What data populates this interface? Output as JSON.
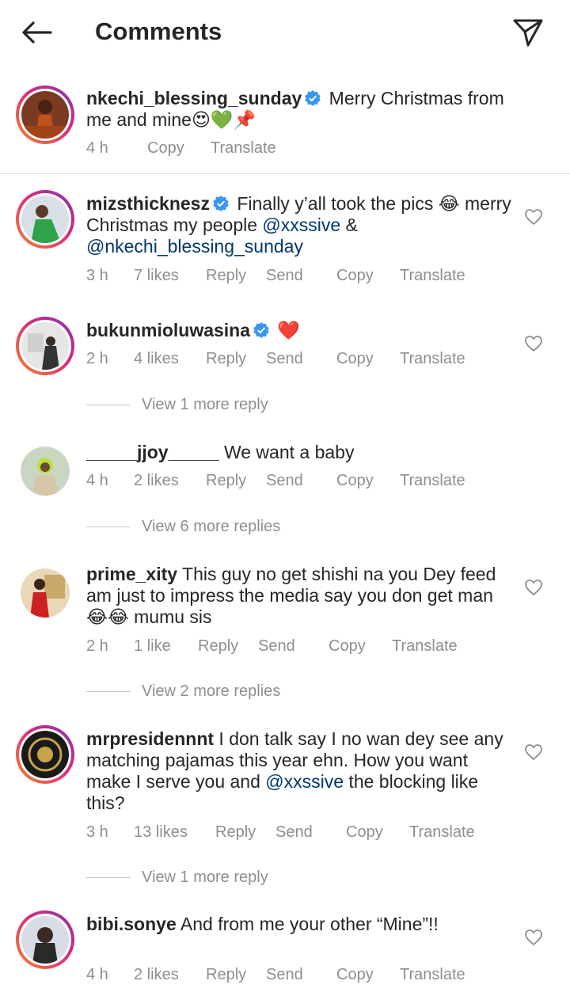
{
  "header": {
    "title": "Comments",
    "back_icon": "back-arrow-icon",
    "send_icon": "paper-plane-icon"
  },
  "caption": {
    "username": "nkechi_blessing_sunday",
    "text": "Merry Christmas from me and mine😍💚📌",
    "time": "4 h",
    "copy": "Copy",
    "translate": "Translate"
  },
  "comments": [
    {
      "username": "mizsthicknesz",
      "text_a": "Finally y’all took the pics 😂 merry Christmas my people ",
      "mention_1": "@xxssive",
      "text_b": " & ",
      "mention_2": "@nkechi_blessing_sunday",
      "time": "3 h",
      "likes": "7 likes",
      "reply": "Reply",
      "send": "Send",
      "copy": "Copy",
      "translate": "Translate"
    },
    {
      "username": "bukunmioluwasina",
      "text": "❤️",
      "time": "2 h",
      "likes": "4 likes",
      "reply": "Reply",
      "send": "Send",
      "copy": "Copy",
      "translate": "Translate",
      "view_replies": "View 1 more reply"
    },
    {
      "username": "_____jjoy_____",
      "text": "We want a baby",
      "time": "4 h",
      "likes": "2 likes",
      "reply": "Reply",
      "send": "Send",
      "copy": "Copy",
      "translate": "Translate",
      "view_replies": "View 6 more replies"
    },
    {
      "username": "prime_xity",
      "text": "This guy no get shishi na you Dey feed am just to impress the media say you don get man 😂😂 mumu sis",
      "time": "2 h",
      "likes": "1 like",
      "reply": "Reply",
      "send": "Send",
      "copy": "Copy",
      "translate": "Translate",
      "view_replies": "View 2 more replies"
    },
    {
      "username": "mrpresidennnt",
      "text_a": "I don talk say I no wan dey see any matching pajamas this year ehn. How you want make I serve you and ",
      "mention_1": "@xxssive",
      "text_b": " the blocking like this?",
      "time": "3 h",
      "likes": "13 likes",
      "reply": "Reply",
      "send": "Send",
      "copy": "Copy",
      "translate": "Translate",
      "view_replies": "View 1 more reply"
    },
    {
      "username": "bibi.sonye",
      "text": "And from me your other “Mine”!!",
      "time": "4 h",
      "likes": "2 likes",
      "reply": "Reply",
      "send": "Send",
      "copy": "Copy",
      "translate": "Translate"
    }
  ],
  "colors": {
    "text": "#262626",
    "secondary": "#8e8e8e",
    "mention": "#00376b",
    "verified": "#3897f0",
    "heart_emoji": "#ed4956"
  }
}
